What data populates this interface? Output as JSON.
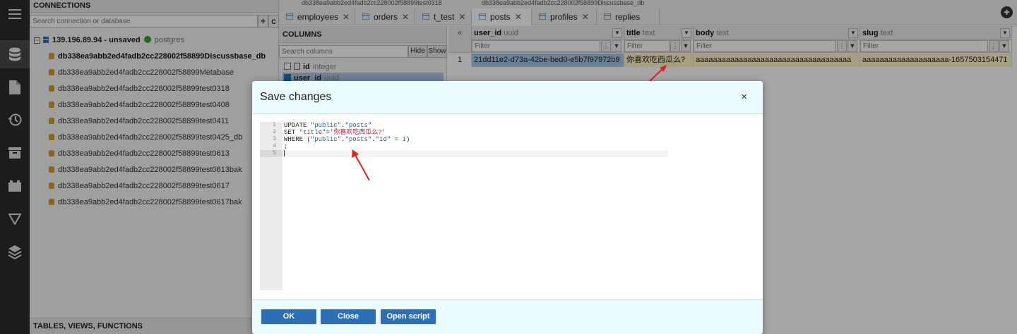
{
  "colors": {
    "accent": "#2d6fb5",
    "modal_header": "#eafcfd",
    "selected_row": "#a8c8e8",
    "sql_constant": "#c8102e",
    "sql_string": "#1a5aa8",
    "arrow": "#e0201c"
  },
  "connections": {
    "title": "CONNECTIONS",
    "search_placeholder": "Search connection or database",
    "add_button": "+",
    "clear_button": "c",
    "server": {
      "name": "139.196.89.94 - unsaved",
      "engine": "postgres",
      "status_icon": "check-circle-icon"
    },
    "databases": [
      "db338ea9abb2ed4fadb2cc228002f58899Discussbase_db",
      "db338ea9abb2ed4fadb2cc228002f58899Metabase",
      "db338ea9abb2ed4fadb2cc228002f58899test0318",
      "db338ea9abb2ed4fadb2cc228002f58899test0408",
      "db338ea9abb2ed4fadb2cc228002f58899test0411",
      "db338ea9abb2ed4fadb2cc228002f58899test0425_db",
      "db338ea9abb2ed4fadb2cc228002f58899test0613",
      "db338ea9abb2ed4fadb2cc228002f58899test0613bak",
      "db338ea9abb2ed4fadb2cc228002f58899test0617",
      "db338ea9abb2ed4fadb2cc228002f58899test0617bak"
    ],
    "bottom_title": "TABLES, VIEWS, FUNCTIONS"
  },
  "sidebar_icons": [
    "menu-icon",
    "database-icon",
    "file-icon",
    "history-icon",
    "archive-icon",
    "plugin-icon",
    "filter-icon",
    "layers-icon"
  ],
  "tabs": {
    "top_labels": [
      "db338ea9abb2ed4fadb2cc228002f58899test0318",
      "db338ea9abb2ed4fadb2cc228002f58899Discussbase_db"
    ],
    "items": [
      "employees",
      "orders",
      "t_test",
      "posts",
      "profiles",
      "replies"
    ],
    "close_glyph": "✕",
    "add_glyph": "+"
  },
  "columns_panel": {
    "title": "COLUMNS",
    "search_placeholder": "Search columns",
    "hide_label": "Hide",
    "show_label": "Show",
    "rows": [
      {
        "name": "id",
        "type": "integer"
      },
      {
        "name": "user_id",
        "type": "uuid"
      }
    ]
  },
  "grid": {
    "collapse_glyph": "«",
    "columns": [
      {
        "name": "user_id",
        "type": "uuid"
      },
      {
        "name": "title",
        "type": "text"
      },
      {
        "name": "body",
        "type": "text"
      },
      {
        "name": "slug",
        "type": "text"
      }
    ],
    "filter_placeholder": "Filter",
    "filter_menu_glyph": "⋮",
    "filter_funnel_glyph": "▼",
    "dropdown_glyph": "▼",
    "row_number": "1",
    "row": [
      "21dd11e2-d73a-42be-bed0-e5b7f97972b9",
      "你喜欢吃西瓜么?",
      "aaaaaaaaaaaaaaaaaaaaaaaaaaaaaaaaaaaa",
      "aaaaaaaaaaaaaaaaaaaa-1657503154471"
    ]
  },
  "modal": {
    "title": "Save changes",
    "close_glyph": "×",
    "line_numbers": [
      "1",
      "2",
      "3",
      "4",
      "5"
    ],
    "sql": {
      "l1_kw": "UPDATE ",
      "l1_s1": "\"public\"",
      "l1_dot": ".",
      "l1_s2": "\"posts\"",
      "l2_kw": "SET ",
      "l2_s1": "\"title\"",
      "l2_eq": "=",
      "l2_val": "'你喜欢吃西瓜么?'",
      "l3_kw": "WHERE (",
      "l3_s1": "\"public\"",
      "l3_d1": ".",
      "l3_s2": "\"posts\"",
      "l3_d2": ".",
      "l3_s3": "\"id\"",
      "l3_eq": " = ",
      "l3_num": "1",
      "l3_end": ")",
      "l4": ";"
    },
    "buttons": {
      "ok": "OK",
      "close": "Close",
      "open_script": "Open script"
    }
  }
}
